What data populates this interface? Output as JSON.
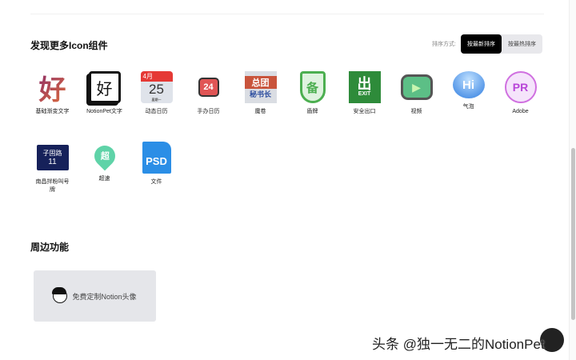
{
  "section_icons": {
    "title": "发现更多Icon组件",
    "sort_label": "排序方式:",
    "sort_options": [
      "按最新排序",
      "按最热排序"
    ],
    "selected_sort": "按最新排序",
    "items": [
      {
        "label": "基础渐变文字",
        "glyph": "好"
      },
      {
        "label": "NotionPet文字",
        "glyph": "好"
      },
      {
        "label": "动态日历",
        "glyph": "25",
        "month": "4月",
        "weekday": "星期一"
      },
      {
        "label": "手办日历",
        "glyph": "24"
      },
      {
        "label": "魔卷",
        "glyph": "总团",
        "sub": "秘书长"
      },
      {
        "label": "盾牌",
        "glyph": "备"
      },
      {
        "label": "安全出口",
        "glyph": "出",
        "sub": "EXIT"
      },
      {
        "label": "视频",
        "glyph": "▶"
      },
      {
        "label": "气泡",
        "glyph": "Hi"
      },
      {
        "label": "Adobe",
        "glyph": "PR"
      },
      {
        "label": "南昌拌粉叫号牌",
        "glyph": "子固路",
        "sub": "11"
      },
      {
        "label": "超速",
        "glyph": "超"
      },
      {
        "label": "文件",
        "glyph": "PSD"
      }
    ]
  },
  "section_extra": {
    "title": "周边功能",
    "card_label": "免费定制Notion头像"
  },
  "watermark": "头条 @独一无二的NotionPet"
}
